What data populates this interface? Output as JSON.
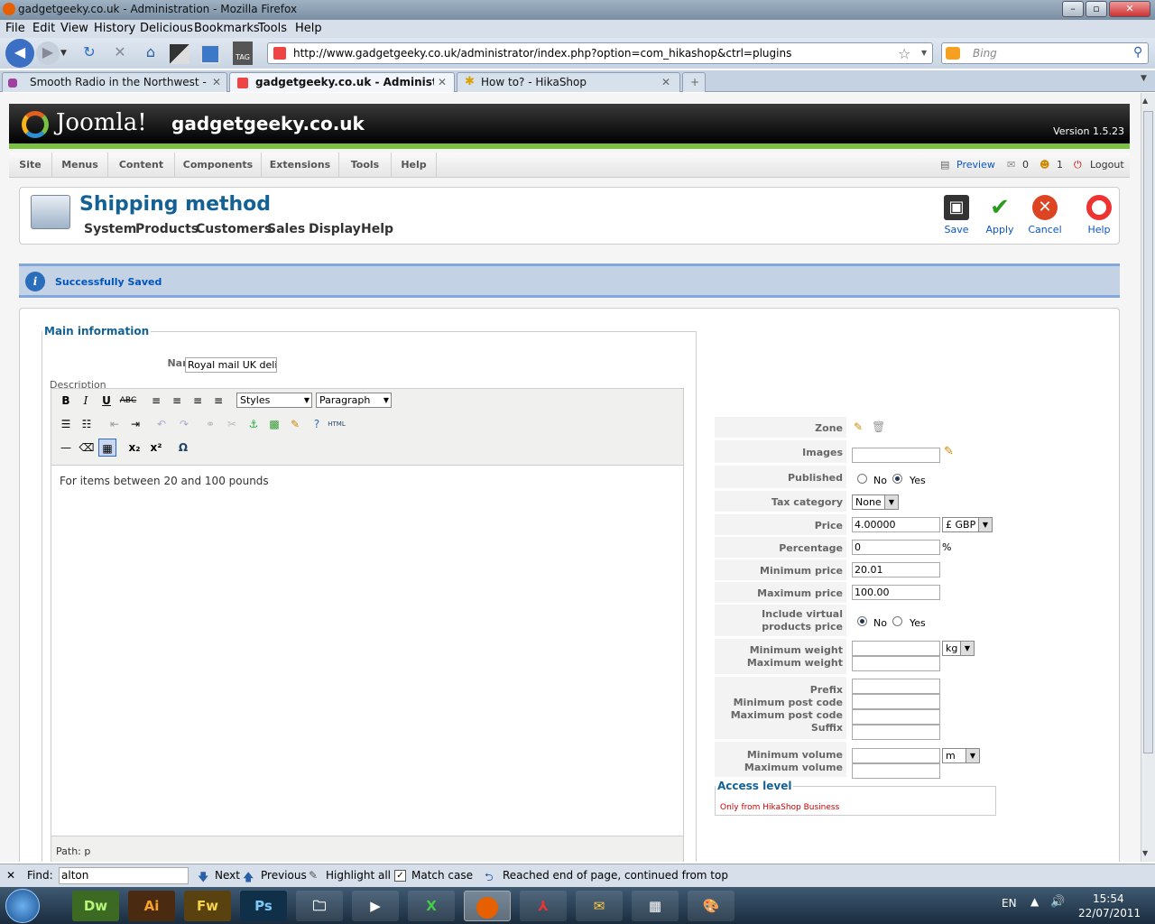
{
  "window": {
    "title": "gadgetgeeky.co.uk - Administration - Mozilla Firefox"
  },
  "menu": [
    "File",
    "Edit",
    "View",
    "History",
    "Delicious",
    "Bookmarks",
    "Tools",
    "Help"
  ],
  "url": "http://www.gadgetgeeky.co.uk/administrator/index.php?option=com_hikashop&ctrl=plugins",
  "search_placeholder": "Bing",
  "tabs": [
    {
      "label": "Smooth Radio in the Northwest - D..."
    },
    {
      "label": "gadgetgeeky.co.uk - Administrati..."
    },
    {
      "label": "How to? - HikaShop"
    }
  ],
  "joomla": {
    "logo": "Joomla!",
    "site": "gadgetgeeky.co.uk",
    "version": "Version 1.5.23"
  },
  "adminmenu": [
    "Site",
    "Menus",
    "Content",
    "Components",
    "Extensions",
    "Tools",
    "Help"
  ],
  "status": {
    "preview": "Preview",
    "count1": "0",
    "count2": "1",
    "logout": "Logout"
  },
  "page": {
    "title": "Shipping method",
    "submenu": [
      "System",
      "Products",
      "Customers",
      "Sales",
      "Display",
      "Help"
    ]
  },
  "toolbar": {
    "save": "Save",
    "apply": "Apply",
    "cancel": "Cancel",
    "help": "Help"
  },
  "message": "Successfully Saved",
  "main": {
    "legend": "Main information",
    "name_label": "Name",
    "name_value": "Royal mail UK delive",
    "description_label": "Description",
    "styles": "Styles",
    "paragraph": "Paragraph",
    "body": "For items between 20 and 100 pounds",
    "path": "Path: p"
  },
  "form": {
    "zone": "Zone",
    "images": "Images",
    "published": "Published",
    "no": "No",
    "yes": "Yes",
    "tax_category": "Tax category",
    "tax_value": "None",
    "price": "Price",
    "price_value": "4.00000",
    "currency": "£ GBP",
    "percentage": "Percentage",
    "percentage_value": "0",
    "percent_sign": "%",
    "min_price": "Minimum price",
    "min_price_value": "20.01",
    "max_price": "Maximum price",
    "max_price_value": "100.00",
    "include_virtual1": "Include virtual",
    "include_virtual2": "products price",
    "min_weight": "Minimum weight",
    "max_weight": "Maximum weight",
    "weight_unit": "kg",
    "prefix": "Prefix",
    "min_post": "Minimum post code",
    "max_post": "Maximum post code",
    "suffix": "Suffix",
    "min_volume": "Minimum volume",
    "max_volume": "Maximum volume",
    "volume_unit": "m",
    "access_legend": "Access level",
    "access_text": "Only from HikaShop Business"
  },
  "find": {
    "label": "Find:",
    "value": "alton",
    "next": "Next",
    "previous": "Previous",
    "highlight": "Highlight all",
    "match": "Match case",
    "status": "Reached end of page, continued from top"
  },
  "taskbar": {
    "apps": [
      "Dw",
      "Ai",
      "Fw",
      "Ps"
    ],
    "lang": "EN",
    "time": "15:54",
    "date": "22/07/2011"
  }
}
